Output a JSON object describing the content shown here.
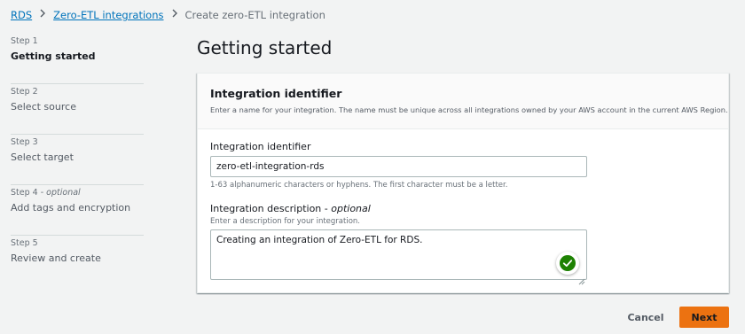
{
  "breadcrumb": {
    "items": [
      "RDS",
      "Zero-ETL integrations"
    ],
    "current": "Create zero-ETL integration"
  },
  "steps": [
    {
      "number": "Step 1",
      "optional": "",
      "label": "Getting started"
    },
    {
      "number": "Step 2",
      "optional": "",
      "label": "Select source"
    },
    {
      "number": "Step 3",
      "optional": "",
      "label": "Select target"
    },
    {
      "number": "Step 4 - ",
      "optional": "optional",
      "label": "Add tags and encryption"
    },
    {
      "number": "Step 5",
      "optional": "",
      "label": "Review and create"
    }
  ],
  "active_step": 1,
  "page_title": "Getting started",
  "panel": {
    "title": "Integration identifier",
    "description": "Enter a name for your integration. The name must be unique across all integrations owned by your AWS account in the current AWS Region."
  },
  "identifier_field": {
    "label": "Integration identifier",
    "value": "zero-etl-integration-rds",
    "hint": "1-63 alphanumeric characters or hyphens. The first character must be a letter."
  },
  "description_field": {
    "label": "Integration description - ",
    "label_optional": "optional",
    "hint": "Enter a description for your integration.",
    "value": "Creating an integration of Zero-ETL for RDS."
  },
  "footer": {
    "cancel_label": "Cancel",
    "next_label": "Next"
  },
  "colors": {
    "link": "#0073bb",
    "primary_button": "#ec7211",
    "success_check": "#1d8102"
  },
  "icons": {
    "breadcrumb_separator": "chevron-right-icon",
    "check": "check-circle-icon",
    "resize": "resize-grip-icon"
  }
}
